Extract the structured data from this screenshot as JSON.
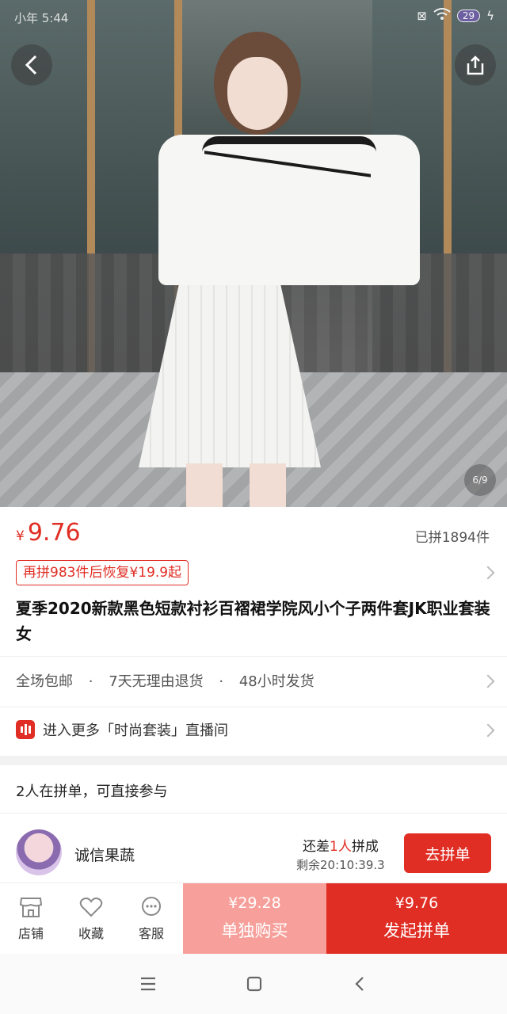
{
  "status_bar": {
    "time": "小年 5:44",
    "battery": "29"
  },
  "gallery": {
    "counter": "6/9"
  },
  "product": {
    "currency": "¥",
    "price": "9.76",
    "sold": "已拼1894件",
    "restore_notice": "再拼983件后恢复¥19.9起",
    "title": "夏季2020新款黑色短款衬衫百褶裙学院风小个子两件套JK职业套装女"
  },
  "services": {
    "items": [
      "全场包邮",
      "7天无理由退货",
      "48小时发货"
    ],
    "separator": "·"
  },
  "live": {
    "text": "进入更多「时尚套装」直播间"
  },
  "group": {
    "header": "2人在拼单，可直接参与",
    "user_name": "诚信果蔬",
    "need_prefix": "还差",
    "need_count": "1人",
    "need_suffix": "拼成",
    "remaining": "剩余20:10:39.3",
    "join_label": "去拼单"
  },
  "bottom_bar": {
    "store_label": "店铺",
    "favorite_label": "收藏",
    "service_label": "客服",
    "alone_price": "¥29.28",
    "alone_label": "单独购买",
    "group_price": "¥9.76",
    "group_label": "发起拼单"
  },
  "colors": {
    "accent": "#e02e24",
    "alone_bg": "#f7a09b"
  },
  "icons": [
    "back-icon",
    "share-icon",
    "chevron-right-icon",
    "live-icon",
    "store-icon",
    "heart-icon",
    "chat-icon",
    "menu-icon",
    "home-icon",
    "back-nav-icon"
  ]
}
